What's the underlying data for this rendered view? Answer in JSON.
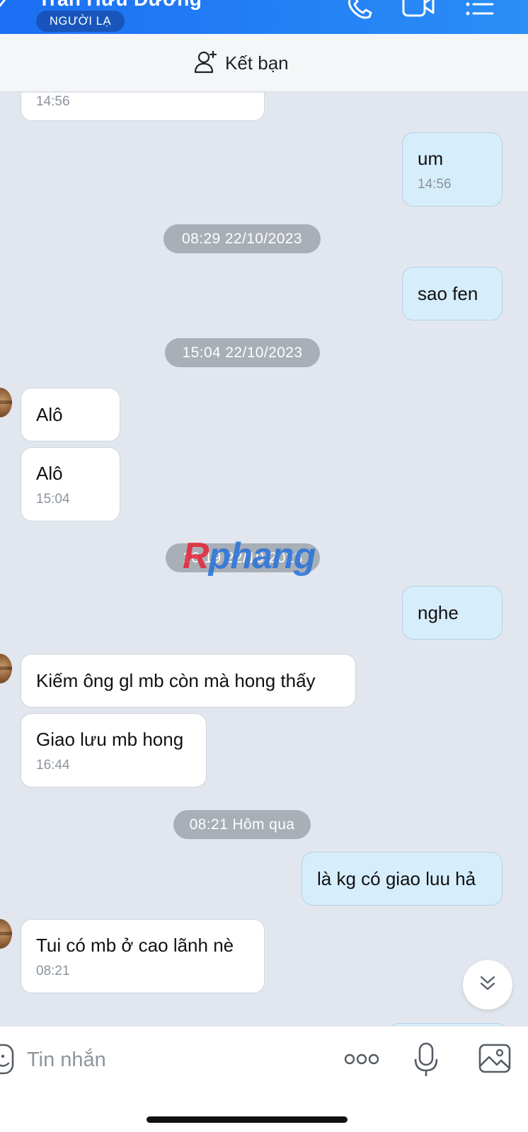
{
  "header": {
    "contact_name": "Trần Hữu Đương",
    "badge": "NGƯỜI LẠ",
    "icons": [
      "back-chevron-icon",
      "phone-icon",
      "video-call-icon",
      "list-menu-icon"
    ]
  },
  "add_friend": {
    "label": "Kết bạn",
    "icon": "add-user-icon"
  },
  "messages": [
    {
      "side": "in",
      "time": "14:56"
    },
    {
      "side": "out",
      "text": "um",
      "time": "14:56"
    },
    {
      "type": "date",
      "label": "08:29 22/10/2023"
    },
    {
      "side": "out",
      "text": "sao fen"
    },
    {
      "type": "date",
      "label": "15:04 22/10/2023"
    },
    {
      "side": "in",
      "text": "Alô"
    },
    {
      "side": "in",
      "text": "Alô",
      "time": "15:04"
    },
    {
      "type": "date",
      "label": "16:19 22/10/2023"
    },
    {
      "side": "out",
      "text": "nghe"
    },
    {
      "side": "in",
      "text": "Kiếm ông gl mb còn mà hong thấy"
    },
    {
      "side": "in",
      "text": "Giao lưu mb hong",
      "time": "16:44"
    },
    {
      "type": "date",
      "label": "08:21 Hôm qua"
    },
    {
      "side": "out",
      "text": "là kg có giao luu hả"
    },
    {
      "side": "in",
      "text": "Tui có mb ở cao lãnh nè",
      "time": "08:21"
    }
  ],
  "watermark": {
    "part1": "R",
    "part2": "phang"
  },
  "input_bar": {
    "placeholder": "Tin nhắn",
    "icons": [
      "sticker-icon",
      "more-icon",
      "microphone-icon",
      "image-icon"
    ]
  },
  "colors": {
    "header_blue": "#1b6ff3",
    "outgoing_bubble": "#d6edfb",
    "incoming_bubble": "#ffffff",
    "chat_background": "#e2e7ef",
    "date_pill": "#a9afb6"
  }
}
